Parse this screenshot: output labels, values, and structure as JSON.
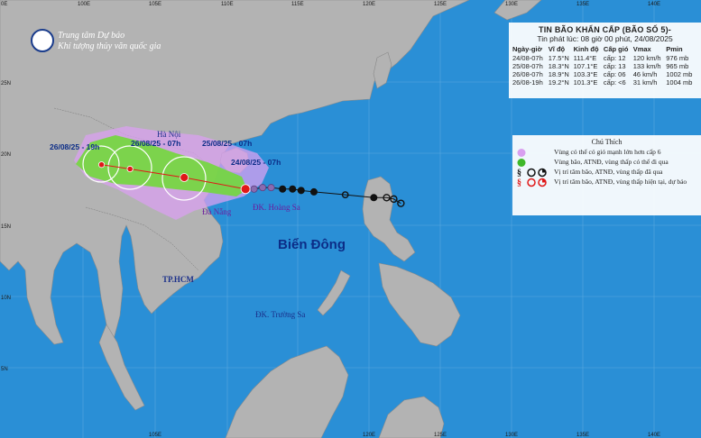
{
  "agency": {
    "line1": "Trung tâm Dự báo",
    "line2": "Khí tượng thủy văn quốc gia"
  },
  "bulletin": {
    "title": "TIN BÃO KHẨN CẤP (BÃO SỐ 5)-",
    "issued": "Tin phát lúc: 08 giờ 00 phút, 24/08/2025",
    "headers": [
      "Ngày-giờ",
      "Vĩ độ",
      "Kinh độ",
      "Cấp gió",
      "Vmax",
      "Pmin"
    ],
    "rows": [
      [
        "24/08-07h",
        "17.5°N",
        "111.4°E",
        "cấp: 12",
        "120 km/h",
        "976 mb"
      ],
      [
        "25/08-07h",
        "18.3°N",
        "107.1°E",
        "cấp: 13",
        "133 km/h",
        "965 mb"
      ],
      [
        "26/08-07h",
        "18.9°N",
        "103.3°E",
        "cấp: 06",
        "46 km/h",
        "1002 mb"
      ],
      [
        "26/08-19h",
        "19.2°N",
        "101.3°E",
        "cấp: <6",
        "31 km/h",
        "1004 mb"
      ]
    ]
  },
  "legend": {
    "title": "Chú Thích",
    "items": [
      "Vùng có thể có gió mạnh lớn hơn cấp 6",
      "Vùng bão, ATNĐ, vùng thấp có thể đi qua",
      "Vị trí tâm bão, ATNĐ, vùng thấp đã qua",
      "Vị trí tâm bão, ATNĐ, vùng thấp hiện tại, dự báo"
    ]
  },
  "places": {
    "ha_noi": "Hà Nội",
    "da_nang": "Đà Nẵng",
    "tp_hcm": "TP.HCM",
    "hoang_sa": "ĐK. Hoàng Sa",
    "truong_sa": "ĐK. Trường Sa",
    "bien_dong": "Biển Đông"
  },
  "forecast_labels": [
    "26/08/25 - 19h",
    "26/08/25 - 07h",
    "25/08/25 - 07h",
    "24/08/25 - 07h"
  ],
  "axes": {
    "lon_ticks": [
      "100E",
      "105E",
      "110E",
      "115E",
      "120E",
      "125E",
      "130E",
      "135E",
      "140E"
    ],
    "lat_ticks": [
      "25N",
      "20N",
      "15N",
      "10N",
      "5N"
    ],
    "corner_label": "0E"
  },
  "colors": {
    "sea": "#2a8fd6",
    "land": "#b3b3b3",
    "strong_wind_zone": "#d9a0f0",
    "storm_zone": "#72d83c",
    "center_red": "#e01818",
    "track_past": "#111111"
  },
  "track": {
    "past": [
      {
        "lon": 122.3,
        "lat": 16.5
      },
      {
        "lon": 121.8,
        "lat": 16.8
      },
      {
        "lon": 121.3,
        "lat": 16.9
      },
      {
        "lon": 120.4,
        "lat": 16.9
      },
      {
        "lon": 118.4,
        "lat": 17.1
      },
      {
        "lon": 116.2,
        "lat": 17.3
      },
      {
        "lon": 115.3,
        "lat": 17.4
      },
      {
        "lon": 114.7,
        "lat": 17.5
      },
      {
        "lon": 114.0,
        "lat": 17.5
      },
      {
        "lon": 113.2,
        "lat": 17.6
      },
      {
        "lon": 112.6,
        "lat": 17.6
      },
      {
        "lon": 112.0,
        "lat": 17.5
      }
    ],
    "current": {
      "lon": 111.4,
      "lat": 17.5
    },
    "forecast": [
      {
        "lon": 107.1,
        "lat": 18.3
      },
      {
        "lon": 103.3,
        "lat": 18.9
      },
      {
        "lon": 101.3,
        "lat": 19.2
      }
    ]
  }
}
